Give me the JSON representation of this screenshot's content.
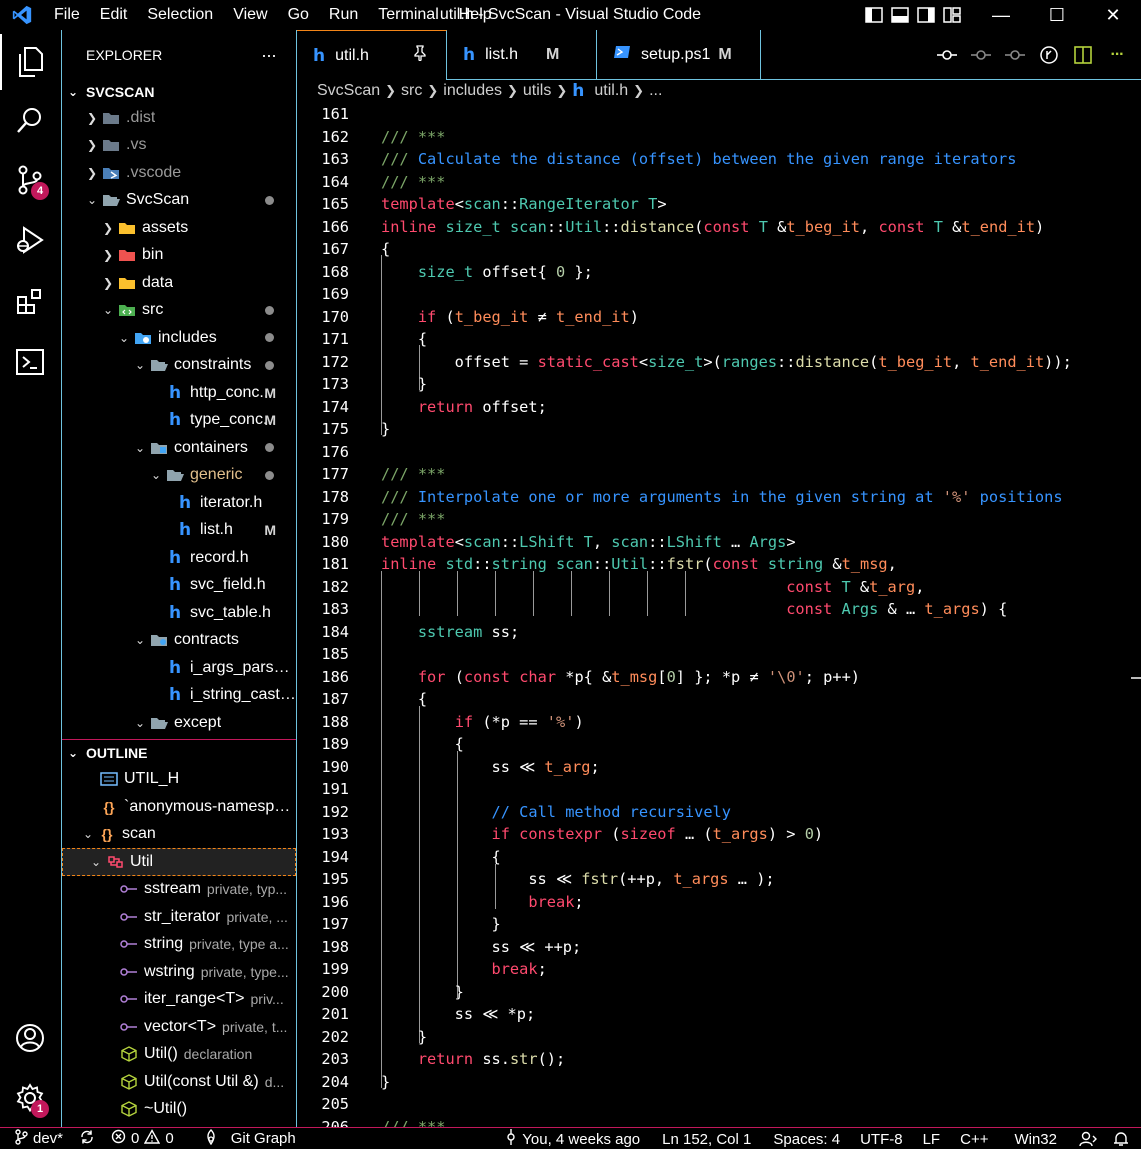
{
  "window": {
    "title": "util.h - SvcScan - Visual Studio Code"
  },
  "menu": [
    "File",
    "Edit",
    "Selection",
    "View",
    "Go",
    "Run",
    "Terminal",
    "Help"
  ],
  "window_controls": {
    "minimize": "—",
    "maximize": "☐",
    "close": "✕"
  },
  "activity_bar": {
    "source_control_badge": "4",
    "accounts_settings_badge": "1"
  },
  "explorer": {
    "title": "EXPLORER",
    "more": "···",
    "root": "SVCSCAN",
    "items": [
      {
        "label": ".dist",
        "dim": true
      },
      {
        "label": ".vs",
        "dim": true
      },
      {
        "label": ".vscode",
        "dim": true
      },
      {
        "label": "SvcScan"
      },
      {
        "label": "assets"
      },
      {
        "label": "bin"
      },
      {
        "label": "data"
      },
      {
        "label": "src"
      },
      {
        "label": "includes"
      },
      {
        "label": "constraints"
      },
      {
        "label": "http_conc...",
        "decoration": "M"
      },
      {
        "label": "type_conc...",
        "decoration": "M"
      },
      {
        "label": "containers"
      },
      {
        "label": "generic"
      },
      {
        "label": "iterator.h"
      },
      {
        "label": "list.h",
        "decoration": "M"
      },
      {
        "label": "record.h"
      },
      {
        "label": "svc_field.h"
      },
      {
        "label": "svc_table.h"
      },
      {
        "label": "contracts"
      },
      {
        "label": "i_args_parser.h"
      },
      {
        "label": "i_string_castabl..."
      },
      {
        "label": "except"
      }
    ]
  },
  "outline": {
    "title": "OUTLINE",
    "items": [
      {
        "label": "UTIL_H"
      },
      {
        "label": "`anonymous-namespa..."
      },
      {
        "label": "scan"
      },
      {
        "label": "Util"
      },
      {
        "label": "sstream",
        "desc": "private, typ..."
      },
      {
        "label": "str_iterator",
        "desc": "private, ..."
      },
      {
        "label": "string",
        "desc": "private, type a..."
      },
      {
        "label": "wstring",
        "desc": "private, type..."
      },
      {
        "label": "iter_range<T>",
        "desc": "priv..."
      },
      {
        "label": "vector<T>",
        "desc": "private, t..."
      },
      {
        "label": "Util()",
        "desc": "declaration"
      },
      {
        "label": "Util(const Util &)",
        "desc": "d..."
      },
      {
        "label": "~Util()"
      }
    ]
  },
  "tabs": [
    {
      "label": "util.h",
      "active": true
    },
    {
      "label": "list.h",
      "decoration": "M"
    },
    {
      "label": "setup.ps1",
      "decoration": "M"
    }
  ],
  "breadcrumb": [
    "SvcScan",
    "src",
    "includes",
    "utils",
    "util.h",
    "..."
  ],
  "editor": {
    "line_numbers": [
      "161",
      "162",
      "163",
      "164",
      "165",
      "166",
      "167",
      "168",
      "169",
      "170",
      "171",
      "172",
      "173",
      "174",
      "175",
      "176",
      "177",
      "178",
      "179",
      "180",
      "181",
      "182",
      "183",
      "184",
      "185",
      "186",
      "187",
      "188",
      "189",
      "190",
      "191",
      "192",
      "193",
      "194",
      "195",
      "196",
      "197",
      "198",
      "199",
      "200",
      "201",
      "202",
      "203",
      "204",
      "205",
      "206"
    ]
  },
  "status": {
    "branch": "dev*",
    "errors": "0",
    "warnings": "0",
    "git_graph": "Git Graph",
    "blame": "You, 4 weeks ago",
    "cursor": "Ln 152, Col 1",
    "spaces": "Spaces: 4",
    "encoding": "UTF-8",
    "eol": "LF",
    "language": "C++",
    "platform": "Win32"
  },
  "colors": {
    "accent_border": "#6fc3df",
    "focus_border": "#f38518",
    "badge": "#c2185b"
  }
}
